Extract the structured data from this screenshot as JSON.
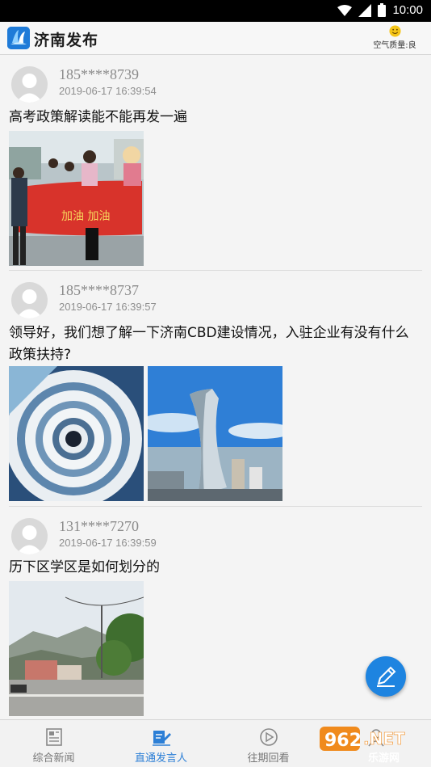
{
  "status_bar": {
    "time": "10:00"
  },
  "header": {
    "title": "济南发布",
    "air_quality": "空气质量:良"
  },
  "posts": [
    {
      "user": "185****8739",
      "time": "2019-06-17  16:39:54",
      "text": "高考政策解读能不能再发一遍",
      "banner_text": "加油 加油"
    },
    {
      "user": "185****8737",
      "time": "2019-06-17  16:39:57",
      "text": "领导好，我们想了解一下济南CBD建设情况，入驻企业有没有什么政策扶持?"
    },
    {
      "user": "131****7270",
      "time": "2019-06-17  16:39:59",
      "text": "历下区学区是如何划分的"
    }
  ],
  "tabs": [
    {
      "label": "综合新闻",
      "icon": "newspaper-icon",
      "active": false
    },
    {
      "label": "直通发言人",
      "icon": "edit-speaker-icon",
      "active": true
    },
    {
      "label": "往期回看",
      "icon": "play-circle-icon",
      "active": false
    },
    {
      "label": "",
      "icon": "user-icon",
      "active": false
    }
  ],
  "watermark": {
    "brand": "962.NET",
    "sub": "乐游网"
  },
  "colors": {
    "accent": "#1e84e0",
    "tab_active": "#2c7fd6",
    "logo_bg": "#1f7bd8"
  }
}
